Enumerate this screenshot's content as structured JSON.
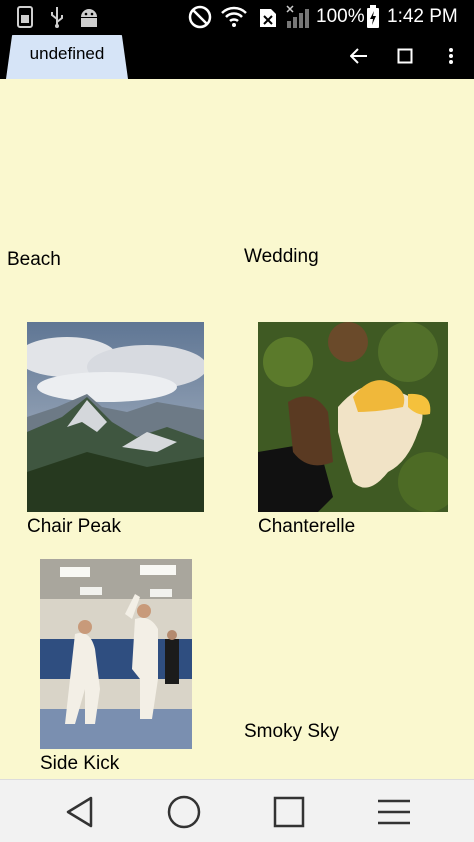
{
  "status_bar": {
    "battery_percent": "100%",
    "time": "1:42 PM"
  },
  "app": {
    "tab_title": "undefined"
  },
  "gallery": {
    "items": [
      {
        "label": "Beach"
      },
      {
        "label": "Wedding"
      },
      {
        "label": "Chair Peak"
      },
      {
        "label": "Chanterelle"
      },
      {
        "label": "Side Kick"
      },
      {
        "label": "Smoky Sky"
      }
    ]
  },
  "colors": {
    "background": "#faf8cf",
    "tab": "#d6e4f7",
    "bars": "#000000"
  }
}
